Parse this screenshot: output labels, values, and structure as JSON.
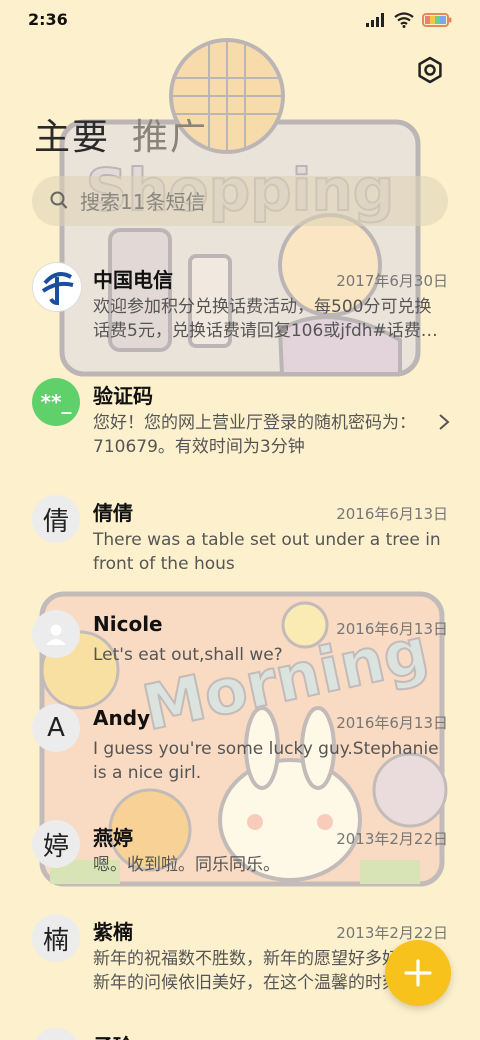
{
  "status_bar": {
    "time": "2:36"
  },
  "tabs": [
    {
      "label": "主要"
    },
    {
      "label": "推广"
    }
  ],
  "search": {
    "placeholder": "搜索11条短信"
  },
  "wallpaper": {
    "top_sticker_text": "Shopping",
    "bottom_sticker_text": "Morning"
  },
  "messages": [
    {
      "name": "中国电信",
      "date": "2017年6月30日",
      "preview": "欢迎参加积分兑换话费活动，每500分可兑换话费5元，兑换话费请回复106或jfdh#话费…",
      "avatar": "china-telecom-logo"
    },
    {
      "name": "验证码",
      "date": "",
      "preview": "您好！您的网上营业厅登录的随机密码为：710679。有效时间为3分钟",
      "avatar_text": "**_"
    },
    {
      "name": "倩倩",
      "date": "2016年6月13日",
      "preview": "There was a table set out under a tree in front of the hous",
      "avatar_text": "倩"
    },
    {
      "name": "Nicole",
      "date": "2016年6月13日",
      "preview": "Let's eat out,shall we?",
      "avatar": "person-icon"
    },
    {
      "name": "Andy",
      "date": "2016年6月13日",
      "preview": "I guess you're some lucky guy.Stephanie is a nice girl.",
      "avatar_text": "A"
    },
    {
      "name": "燕婷",
      "date": "2013年2月22日",
      "preview": "嗯。收到啦。同乐同乐。",
      "avatar_text": "婷"
    },
    {
      "name": "紫楠",
      "date": "2013年2月22日",
      "preview": "新年的祝福数不胜数，新年的愿望好多好多，新年的问候依旧美好，在这个温馨的时刻",
      "avatar_text": "楠"
    },
    {
      "name": "子玲",
      "date": "",
      "preview": "",
      "avatar_text": ""
    }
  ],
  "colors": {
    "background": "#fdf1cd",
    "fab": "#f7c21c",
    "verify_avatar": "#5fd06a",
    "telecom_blue": "#1a4fa0"
  }
}
